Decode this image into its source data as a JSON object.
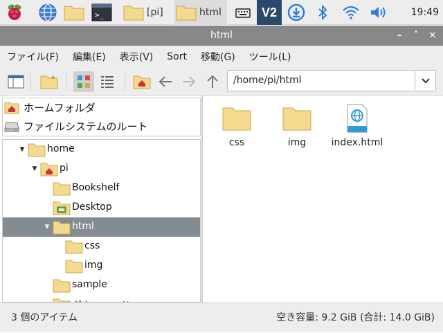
{
  "taskbar": {
    "tasks": [
      {
        "label": "[pi]",
        "icon": "folder-icon"
      },
      {
        "label": "html",
        "icon": "folder-icon"
      }
    ],
    "clock": "19:49",
    "vnc_label": "V2"
  },
  "window": {
    "title": "html"
  },
  "menu": [
    "ファイル(F)",
    "編集(E)",
    "表示(V)",
    "Sort",
    "移動(G)",
    "ツール(L)"
  ],
  "path": "/home/pi/html",
  "places": [
    {
      "label": "ホームフォルダ",
      "icon": "home-folder-icon"
    },
    {
      "label": "ファイルシステムのルート",
      "icon": "drive-icon"
    }
  ],
  "tree": [
    {
      "label": "home",
      "level": 1,
      "expanded": true,
      "icon": "folder-icon",
      "selected": false
    },
    {
      "label": "pi",
      "level": 2,
      "expanded": true,
      "icon": "home-folder-icon",
      "selected": false
    },
    {
      "label": "Bookshelf",
      "level": 3,
      "expanded": false,
      "icon": "folder-icon",
      "selected": false
    },
    {
      "label": "Desktop",
      "level": 3,
      "expanded": false,
      "icon": "desktop-folder-icon",
      "selected": false
    },
    {
      "label": "html",
      "level": 3,
      "expanded": true,
      "icon": "folder-icon",
      "selected": true
    },
    {
      "label": "css",
      "level": 4,
      "expanded": false,
      "icon": "folder-icon",
      "selected": false
    },
    {
      "label": "img",
      "level": 4,
      "expanded": false,
      "icon": "folder-icon",
      "selected": false
    },
    {
      "label": "sample",
      "level": 3,
      "expanded": false,
      "icon": "folder-icon",
      "selected": false
    },
    {
      "label": "ダウンロード",
      "level": 3,
      "expanded": false,
      "icon": "download-folder-icon",
      "selected": false
    }
  ],
  "files": [
    {
      "name": "css",
      "icon": "folder-icon"
    },
    {
      "name": "img",
      "icon": "folder-icon"
    },
    {
      "name": "index.html",
      "icon": "html-file-icon"
    }
  ],
  "status": {
    "left": "3 個のアイテム",
    "right": "空き容量: 9.2 GiB (合計: 14.0 GiB)"
  },
  "colors": {
    "titlebar": "#888888",
    "selection": "#838b93",
    "folder": "#f4d98e",
    "folder_stroke": "#c9a94d",
    "home_red": "#cc3333"
  }
}
